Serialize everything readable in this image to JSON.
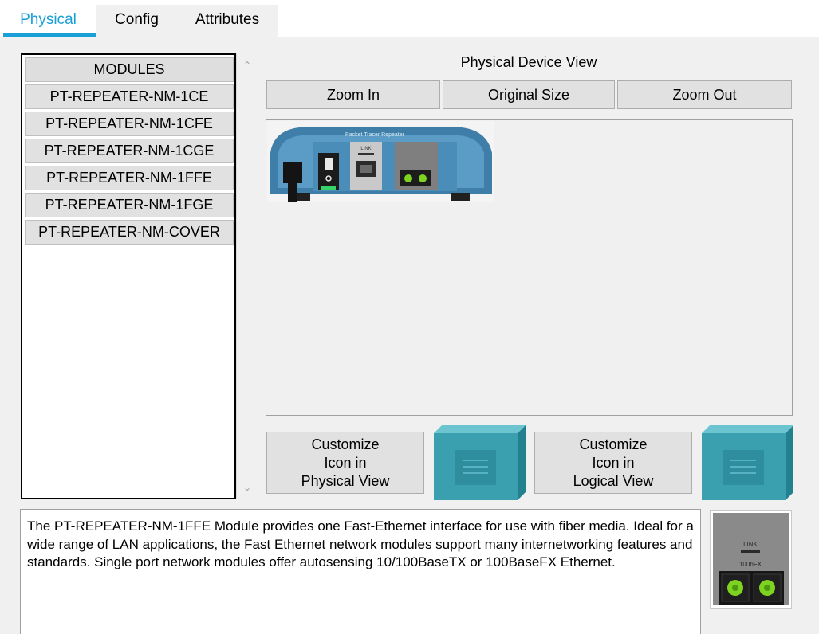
{
  "tabs": [
    {
      "label": "Physical",
      "active": true
    },
    {
      "label": "Config",
      "active": false
    },
    {
      "label": "Attributes",
      "active": false
    }
  ],
  "modules": {
    "header": "MODULES",
    "items": [
      "PT-REPEATER-NM-1CE",
      "PT-REPEATER-NM-1CFE",
      "PT-REPEATER-NM-1CGE",
      "PT-REPEATER-NM-1FFE",
      "PT-REPEATER-NM-1FGE",
      "PT-REPEATER-NM-COVER"
    ]
  },
  "physical_view": {
    "title": "Physical Device View",
    "zoom_in": "Zoom In",
    "original_size": "Original Size",
    "zoom_out": "Zoom Out",
    "device_label": "Packet Tracer Repeater",
    "port_label": "LINK"
  },
  "customize": {
    "physical": [
      "Customize",
      "Icon in",
      "Physical View"
    ],
    "logical": [
      "Customize",
      "Icon in",
      "Logical View"
    ]
  },
  "description": "The PT-REPEATER-NM-1FFE Module provides one Fast-Ethernet interface for use with fiber media. Ideal for a wide range of LAN applications, the Fast Ethernet network modules support many internetworking features and standards. Single port network modules offer autosensing 10/100BaseTX or 100BaseFX Ethernet.",
  "module_thumb": {
    "link_label": "LINK",
    "port_label": "100bFX"
  },
  "colors": {
    "accent": "#1a9fd8",
    "device_blue": "#3f7ea8",
    "cube": "#3aa0b0",
    "port_green": "#7ed321"
  }
}
